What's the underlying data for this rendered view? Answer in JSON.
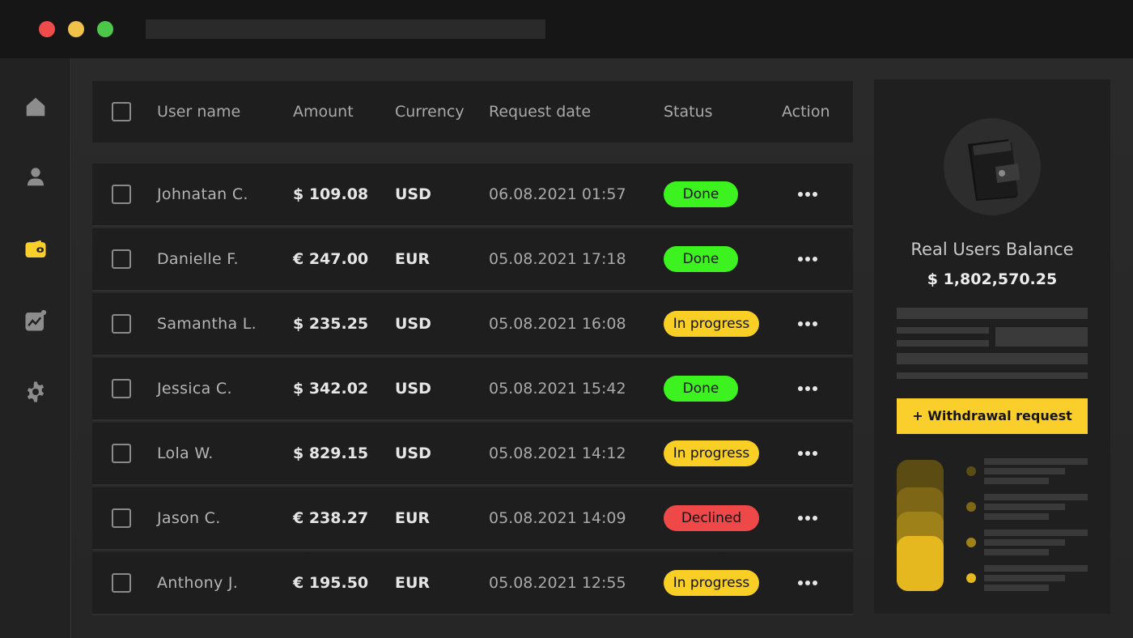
{
  "table": {
    "headers": {
      "user_name": "User name",
      "amount": "Amount",
      "currency": "Currency",
      "request_date": "Request date",
      "status": "Status",
      "action": "Action"
    },
    "rows": [
      {
        "name": "Johnatan C.",
        "amount": "$ 109.08",
        "currency": "USD",
        "date": "06.08.2021 01:57",
        "status": "Done"
      },
      {
        "name": "Danielle F.",
        "amount": "€ 247.00",
        "currency": "EUR",
        "date": "05.08.2021 17:18",
        "status": "Done"
      },
      {
        "name": "Samantha L.",
        "amount": "$ 235.25",
        "currency": "USD",
        "date": "05.08.2021 16:08",
        "status": "In progress"
      },
      {
        "name": "Jessica C.",
        "amount": "$ 342.02",
        "currency": "USD",
        "date": "05.08.2021 15:42",
        "status": "Done"
      },
      {
        "name": "Lola W.",
        "amount": "$ 829.15",
        "currency": "USD",
        "date": "05.08.2021 14:12",
        "status": "In progress"
      },
      {
        "name": "Jason C.",
        "amount": "€ 238.27",
        "currency": "EUR",
        "date": "05.08.2021 14:09",
        "status": "Declined"
      },
      {
        "name": "Anthony J.",
        "amount": "€ 195.50",
        "currency": "EUR",
        "date": "05.08.2021 12:55",
        "status": "In progress"
      }
    ]
  },
  "balance": {
    "title": "Real Users Balance",
    "value": "$ 1,802,570.25",
    "withdraw_label": "+ Withdrawal request"
  },
  "sidebar": {
    "items": [
      {
        "icon": "home-icon",
        "active": false
      },
      {
        "icon": "user-icon",
        "active": false
      },
      {
        "icon": "wallet-icon",
        "active": true
      },
      {
        "icon": "analytics-icon",
        "active": false
      },
      {
        "icon": "gear-icon",
        "active": false
      }
    ]
  },
  "colors": {
    "accent": "#fbcf2b",
    "done": "#3cf21f",
    "in_progress": "#f9cf26",
    "declined": "#ee4848"
  }
}
